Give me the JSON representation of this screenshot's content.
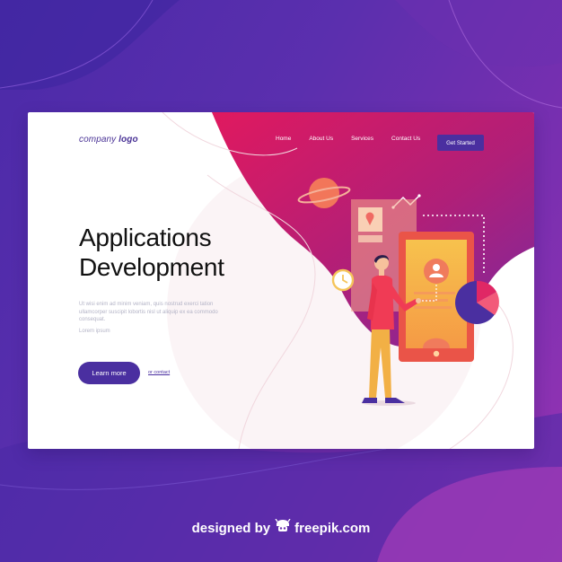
{
  "header": {
    "logo_text_1": "company",
    "logo_text_2": "logo",
    "nav": [
      {
        "label": "Home"
      },
      {
        "label": "About Us"
      },
      {
        "label": "Services"
      },
      {
        "label": "Contact Us"
      }
    ],
    "cta_label": "Get Started"
  },
  "hero": {
    "title_line1": "Applications",
    "title_line2": "Development",
    "body": "Ut wisi enim ad minim veniam, quis nostrud exerci tation ullamcorper suscipit lobortis nisl ut aliquip ex ea commodo consequat.",
    "sub": "Lorem ipsum",
    "primary_button": "Learn more",
    "secondary_link": "or contact"
  },
  "footer": {
    "designed_by": "designed by",
    "brand": "freepik.com"
  },
  "icons": {
    "planet": "planet-icon",
    "clock": "clock-icon",
    "map_pin": "map-pin-icon",
    "user": "user-avatar-icon",
    "pie": "pie-chart-icon",
    "freepik": "freepik-logo-icon"
  },
  "colors": {
    "background_start": "#4b2aa8",
    "background_end": "#9a35b4",
    "accent": "#4a2fa0",
    "blob_start": "#e0195f",
    "blob_end": "#7a2aa0",
    "phone": "#f0594e",
    "shirt": "#f03b55",
    "pants": "#f2b045"
  }
}
